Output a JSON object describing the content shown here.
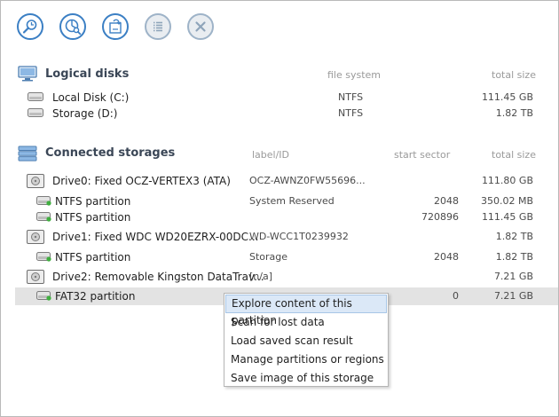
{
  "toolbar": {
    "buttons": [
      {
        "icon": "search-icon"
      },
      {
        "icon": "pie-chart-search-icon"
      },
      {
        "icon": "load-scan-icon"
      },
      {
        "icon": "list-icon"
      },
      {
        "icon": "close-icon"
      }
    ],
    "accent": "#3b7fc4"
  },
  "logical": {
    "title": "Logical disks",
    "col_fs": "file system",
    "col_size": "total size",
    "rows": [
      {
        "name": "Local Disk (C:)",
        "fs": "NTFS",
        "size": "111.45 GB"
      },
      {
        "name": "Storage (D:)",
        "fs": "NTFS",
        "size": "1.82 TB"
      }
    ]
  },
  "storages": {
    "title": "Connected storages",
    "col_label": "label/ID",
    "col_start": "start sector",
    "col_size": "total size",
    "rows": [
      {
        "name": "Drive0: Fixed OCZ-VERTEX3 (ATA)",
        "label": "OCZ-AWNZ0FW55696...",
        "start": "",
        "size": "111.80 GB"
      },
      {
        "name": "NTFS partition",
        "label": "System Reserved",
        "start": "2048",
        "size": "350.02 MB"
      },
      {
        "name": "NTFS partition",
        "label": "",
        "start": "720896",
        "size": "111.45 GB"
      },
      {
        "name": "Drive1: Fixed WDC WD20EZRX-00DC...",
        "label": "WD-WCC1T0239932",
        "start": "",
        "size": "1.82 TB"
      },
      {
        "name": "NTFS partition",
        "label": "Storage",
        "start": "2048",
        "size": "1.82 TB"
      },
      {
        "name": "Drive2: Removable Kingston DataTrav...",
        "label": "[n/a]",
        "start": "",
        "size": "7.21 GB"
      },
      {
        "name": "FAT32 partition",
        "label": "",
        "start": "0",
        "size": "7.21 GB"
      }
    ]
  },
  "context_menu": {
    "items": [
      "Explore content of this partition",
      "Scan for lost data",
      "Load saved scan result",
      "Manage partitions or regions",
      "Save image of this storage"
    ]
  }
}
